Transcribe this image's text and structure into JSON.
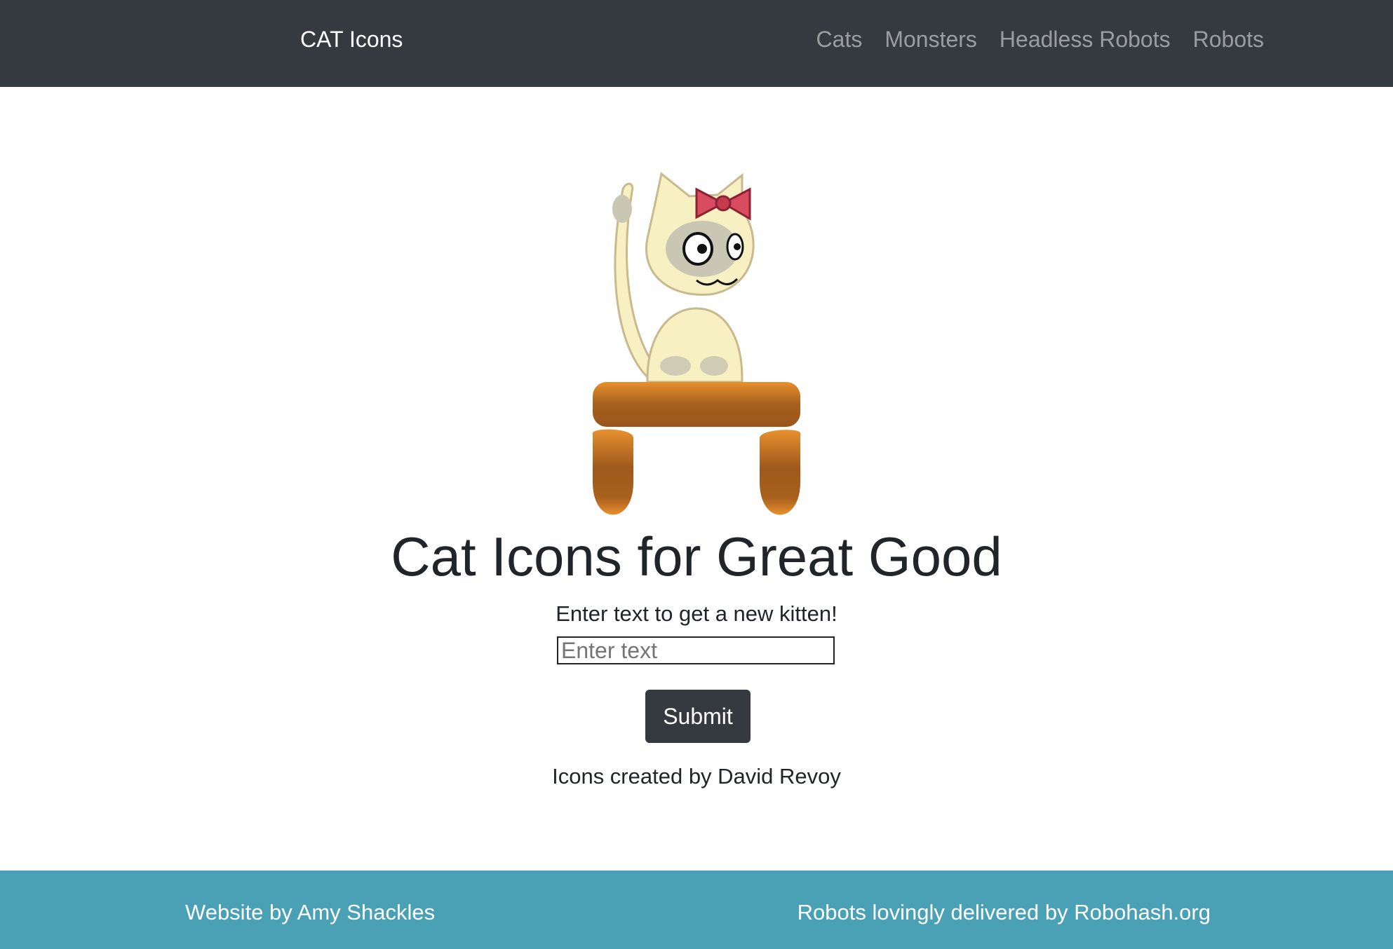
{
  "navbar": {
    "brand": "CAT Icons",
    "links": [
      {
        "label": "Cats"
      },
      {
        "label": "Monsters"
      },
      {
        "label": "Headless Robots"
      },
      {
        "label": "Robots"
      }
    ],
    "background": "#343a40"
  },
  "hero": {
    "image_icon": "cat-on-stool-illustration",
    "title": "Cat Icons for Great Good",
    "prompt": "Enter text to get a new kitten!",
    "input": {
      "value": "",
      "placeholder": "Enter text"
    },
    "submit_label": "Submit",
    "credit": "Icons created by David Revoy"
  },
  "footer": {
    "left_text": "Website by Amy Shackles",
    "right_text": "Robots lovingly delivered by Robohash.org",
    "background": "#4aa0b5"
  }
}
